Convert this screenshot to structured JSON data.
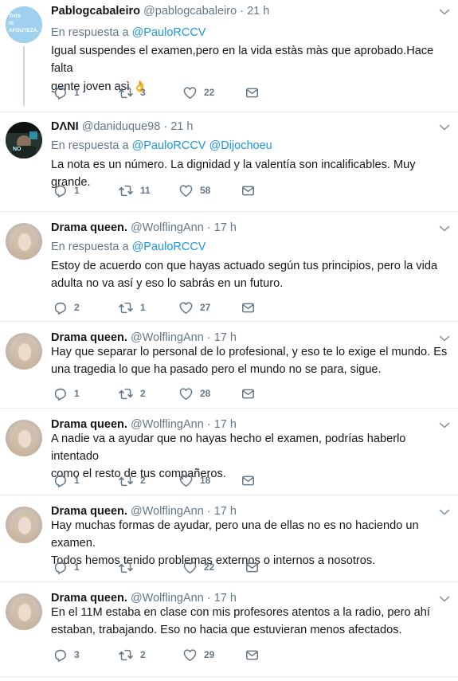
{
  "reply_prefix": "En respuesta a",
  "colors": {
    "link": "#1b95e0",
    "muted": "#657786",
    "border": "#e6ecf0"
  },
  "tweets": [
    {
      "name": "Pablogcabaleiro",
      "handle": "@pablogcabaleiro",
      "time": "21 h",
      "replying_to": [
        "@PauloRCCV"
      ],
      "text_lines": [
        "Igual suspendes el examen,pero en la vida estàs màs que aprobado.Hace falta",
        "gente joven asì"
      ],
      "emoji": "👌",
      "avatar_icon": "avatar-image",
      "avatar_text": "THIS IS AFOUTEZA.",
      "replies": "1",
      "retweets": "3",
      "likes": "22"
    },
    {
      "name": "DΛNI",
      "handle": "@daniduque98",
      "time": "21 h",
      "replying_to": [
        "@PauloRCCV",
        "@Dijochoeu"
      ],
      "text_lines": [
        "La nota es un número. La dignidad y la valentía son incalificables. Muy grande."
      ],
      "avatar_icon": "avatar-image",
      "replies": "1",
      "retweets": "11",
      "likes": "58"
    },
    {
      "name": "Drama queen.",
      "handle": "@WolflingAnn",
      "time": "17 h",
      "replying_to": [
        "@PauloRCCV"
      ],
      "text_lines": [
        "Estoy de acuerdo con que hayas actuado según tus principios, pero la vida",
        "adulta no va así y eso lo sabrás en un futuro."
      ],
      "avatar_icon": "avatar-image",
      "replies": "2",
      "retweets": "1",
      "likes": "27"
    },
    {
      "name": "Drama queen.",
      "handle": "@WolflingAnn",
      "time": "17 h",
      "text_lines": [
        "Hay que separar lo personal de lo profesional, y eso te lo exige el mundo. Es",
        "una tragedia lo que ha pasado pero el mundo no se para, sigue."
      ],
      "avatar_icon": "avatar-image",
      "replies": "1",
      "retweets": "2",
      "likes": "28"
    },
    {
      "name": "Drama queen.",
      "handle": "@WolflingAnn",
      "time": "17 h",
      "text_lines": [
        "A nadie va a ayudar que no hayas hecho el examen, podrías haberlo intentado",
        "como el resto de tus compañeros."
      ],
      "avatar_icon": "avatar-image",
      "replies": "1",
      "retweets": "2",
      "likes": "18"
    },
    {
      "name": "Drama queen.",
      "handle": "@WolflingAnn",
      "time": "17 h",
      "text_lines": [
        "Hay muchas formas de ayudar, pero una de ellas no es no haciendo un examen.",
        "Todos hemos tenido problemas externos o internos a nosotros."
      ],
      "avatar_icon": "avatar-image",
      "replies": "1",
      "retweets": "",
      "likes": "22"
    },
    {
      "name": "Drama queen.",
      "handle": "@WolflingAnn",
      "time": "17 h",
      "text_lines": [
        "En el 11M estaba en clase con mis profesores atentos a la radio, pero ahí",
        "estaban, trabajando. Eso no hacia que estuvieran menos afectados."
      ],
      "avatar_icon": "avatar-image",
      "replies": "3",
      "retweets": "2",
      "likes": "29"
    }
  ]
}
